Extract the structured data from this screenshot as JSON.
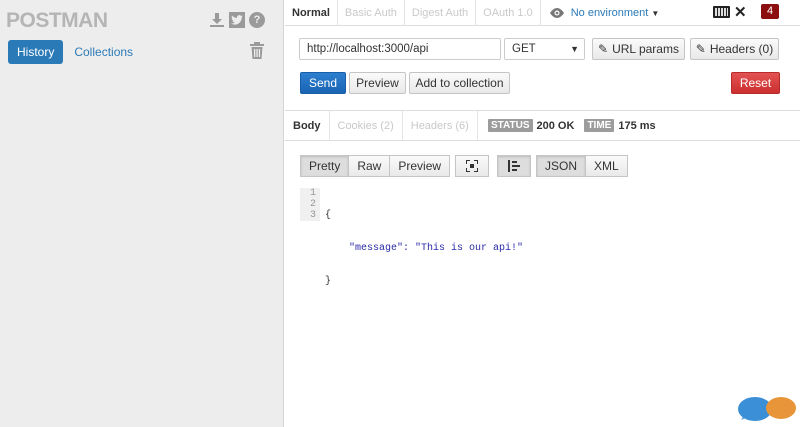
{
  "app": {
    "name": "POSTMAN"
  },
  "sidebar": {
    "tabs": [
      {
        "label": "History",
        "active": true
      },
      {
        "label": "Collections",
        "active": false
      }
    ],
    "icons": [
      "download-icon",
      "twitter-icon",
      "help-icon",
      "trash-icon"
    ]
  },
  "top_tabs": [
    {
      "label": "Normal",
      "active": true
    },
    {
      "label": "Basic Auth",
      "active": false
    },
    {
      "label": "Digest Auth",
      "active": false
    },
    {
      "label": "OAuth 1.0",
      "active": false
    }
  ],
  "environment": {
    "label": "No environment",
    "icon": "eye-icon"
  },
  "notification_count": "4",
  "request": {
    "url": "http://localhost:3000/api",
    "method": "GET",
    "url_params_label": "URL params",
    "headers_label": "Headers (0)"
  },
  "actions": {
    "send": "Send",
    "preview": "Preview",
    "add_to_collection": "Add to collection",
    "reset": "Reset"
  },
  "response": {
    "tabs": [
      {
        "label": "Body",
        "active": true
      },
      {
        "label": "Cookies (2)",
        "active": false
      },
      {
        "label": "Headers (6)",
        "active": false
      }
    ],
    "status_label": "STATUS",
    "status_value": "200 OK",
    "time_label": "TIME",
    "time_value": "175 ms",
    "format_buttons": [
      "Pretty",
      "Raw",
      "Preview"
    ],
    "lang_buttons": [
      "JSON",
      "XML"
    ],
    "body_lines": [
      "{",
      "    \"message\": \"This is our api!\"",
      "}"
    ],
    "line_numbers": [
      "1",
      "2",
      "3"
    ]
  },
  "colors": {
    "accent": "#2b7ab8",
    "send": "#1a63b2",
    "reset": "#cc2f2f",
    "badge": "#8b0f0f"
  }
}
